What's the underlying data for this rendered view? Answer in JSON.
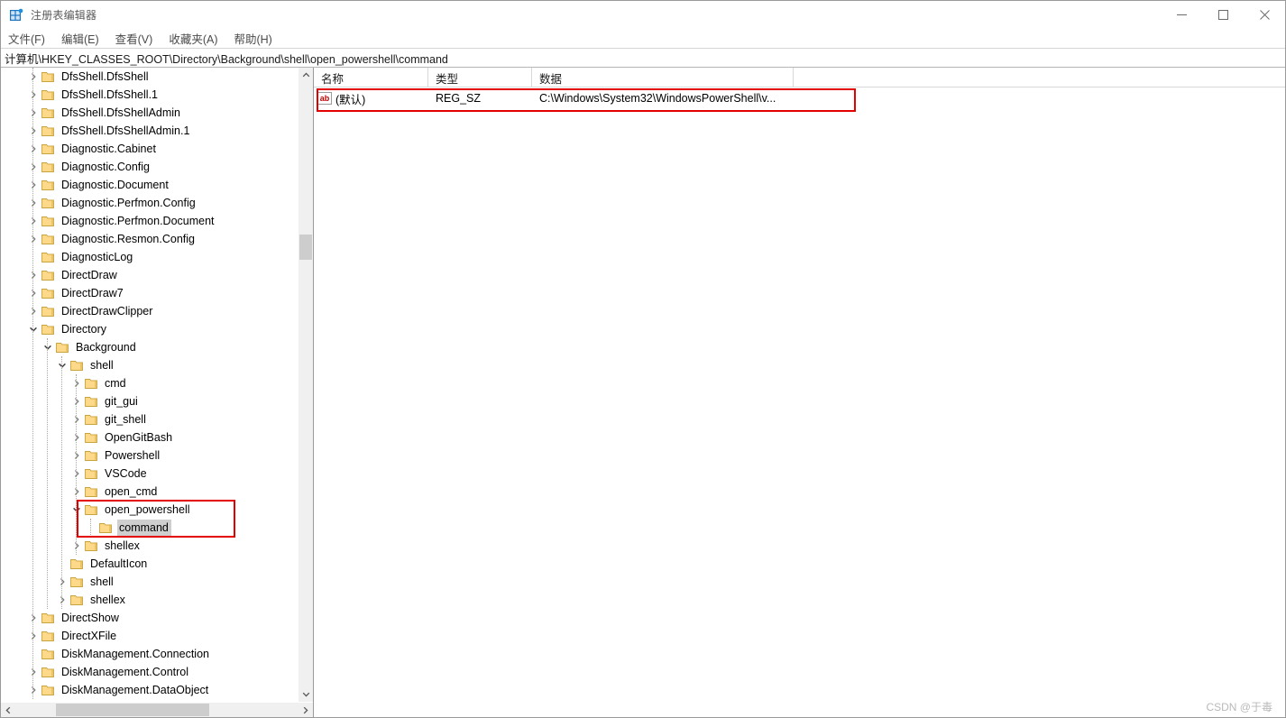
{
  "window": {
    "title": "注册表编辑器",
    "icon": "registry-editor-icon",
    "minimize_label": "─",
    "maximize_label": "□",
    "close_label": "✕"
  },
  "menubar": {
    "items": [
      {
        "label": "文件(F)",
        "name": "menu-file"
      },
      {
        "label": "编辑(E)",
        "name": "menu-edit"
      },
      {
        "label": "查看(V)",
        "name": "menu-view"
      },
      {
        "label": "收藏夹(A)",
        "name": "menu-favorites"
      },
      {
        "label": "帮助(H)",
        "name": "menu-help"
      }
    ]
  },
  "address": {
    "path": "计算机\\HKEY_CLASSES_ROOT\\Directory\\Background\\shell\\open_powershell\\command"
  },
  "tree": {
    "items": [
      {
        "label": "DfsShell.DfsShell",
        "depth": 1,
        "state": "collapsed"
      },
      {
        "label": "DfsShell.DfsShell.1",
        "depth": 1,
        "state": "collapsed"
      },
      {
        "label": "DfsShell.DfsShellAdmin",
        "depth": 1,
        "state": "collapsed"
      },
      {
        "label": "DfsShell.DfsShellAdmin.1",
        "depth": 1,
        "state": "collapsed"
      },
      {
        "label": "Diagnostic.Cabinet",
        "depth": 1,
        "state": "collapsed"
      },
      {
        "label": "Diagnostic.Config",
        "depth": 1,
        "state": "collapsed"
      },
      {
        "label": "Diagnostic.Document",
        "depth": 1,
        "state": "collapsed"
      },
      {
        "label": "Diagnostic.Perfmon.Config",
        "depth": 1,
        "state": "collapsed"
      },
      {
        "label": "Diagnostic.Perfmon.Document",
        "depth": 1,
        "state": "collapsed"
      },
      {
        "label": "Diagnostic.Resmon.Config",
        "depth": 1,
        "state": "collapsed"
      },
      {
        "label": "DiagnosticLog",
        "depth": 1,
        "state": "leaf"
      },
      {
        "label": "DirectDraw",
        "depth": 1,
        "state": "collapsed"
      },
      {
        "label": "DirectDraw7",
        "depth": 1,
        "state": "collapsed"
      },
      {
        "label": "DirectDrawClipper",
        "depth": 1,
        "state": "collapsed"
      },
      {
        "label": "Directory",
        "depth": 1,
        "state": "expanded"
      },
      {
        "label": "Background",
        "depth": 2,
        "state": "expanded"
      },
      {
        "label": "shell",
        "depth": 3,
        "state": "expanded"
      },
      {
        "label": "cmd",
        "depth": 4,
        "state": "collapsed"
      },
      {
        "label": "git_gui",
        "depth": 4,
        "state": "collapsed"
      },
      {
        "label": "git_shell",
        "depth": 4,
        "state": "collapsed"
      },
      {
        "label": "OpenGitBash",
        "depth": 4,
        "state": "collapsed"
      },
      {
        "label": "Powershell",
        "depth": 4,
        "state": "collapsed"
      },
      {
        "label": "VSCode",
        "depth": 4,
        "state": "collapsed"
      },
      {
        "label": "open_cmd",
        "depth": 4,
        "state": "collapsed"
      },
      {
        "label": "open_powershell",
        "depth": 4,
        "state": "expanded"
      },
      {
        "label": "command",
        "depth": 5,
        "state": "leaf",
        "selected": true
      },
      {
        "label": "shellex",
        "depth": 4,
        "state": "collapsed"
      },
      {
        "label": "DefaultIcon",
        "depth": 3,
        "state": "leaf"
      },
      {
        "label": "shell",
        "depth": 3,
        "state": "collapsed"
      },
      {
        "label": "shellex",
        "depth": 3,
        "state": "collapsed"
      },
      {
        "label": "DirectShow",
        "depth": 1,
        "state": "collapsed"
      },
      {
        "label": "DirectXFile",
        "depth": 1,
        "state": "collapsed"
      },
      {
        "label": "DiskManagement.Connection",
        "depth": 1,
        "state": "leaf"
      },
      {
        "label": "DiskManagement.Control",
        "depth": 1,
        "state": "collapsed"
      },
      {
        "label": "DiskManagement.DataObject",
        "depth": 1,
        "state": "collapsed"
      }
    ]
  },
  "values": {
    "columns": [
      "名称",
      "类型",
      "数据"
    ],
    "rows": [
      {
        "icon": "string-value-icon",
        "name": "(默认)",
        "type": "REG_SZ",
        "data": "C:\\Windows\\System32\\WindowsPowerShell\\v...",
        "highlighted": true
      }
    ]
  },
  "annotations": {
    "highlight_color": "#e50000"
  },
  "watermark": {
    "text": "CSDN @于毒"
  },
  "scroll": {
    "tree_up_arrow": "⌃",
    "tree_down_arrow": "⌄",
    "left_arrow": "‹",
    "right_arrow": "›"
  }
}
